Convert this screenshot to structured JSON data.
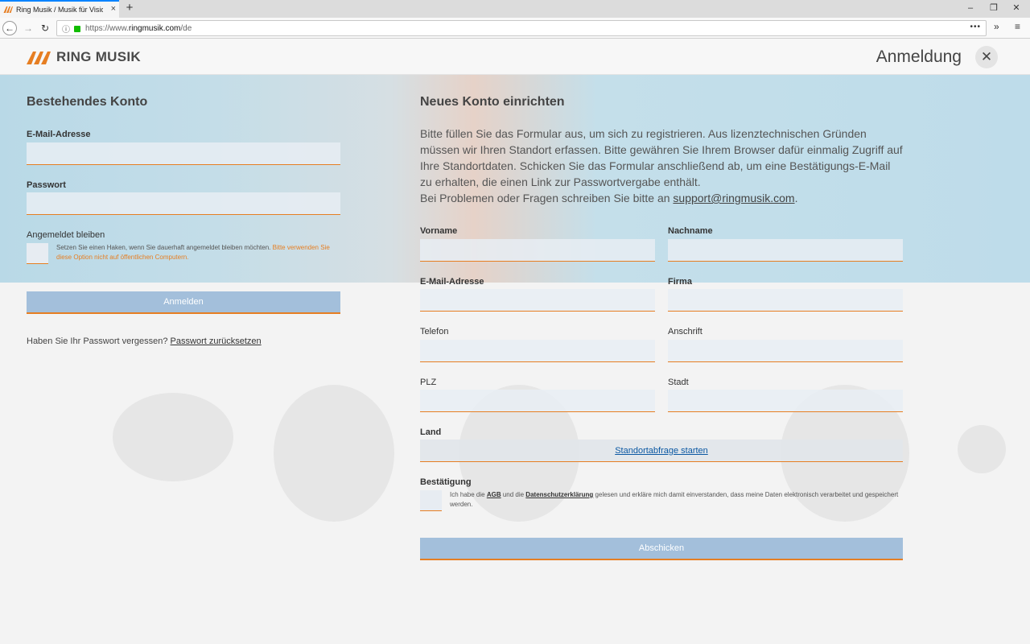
{
  "browser": {
    "tab_title": "Ring Musik / Musik für Visionen",
    "tab_close": "×",
    "new_tab": "+",
    "url_scheme": "https://www.",
    "url_host": "ringmusik.com",
    "url_path": "/de",
    "url_more": "•••",
    "overflow": "»",
    "menu": "≡",
    "win_minimize": "–",
    "win_restore": "❐",
    "win_close": "✕"
  },
  "header": {
    "logo_text": "RING MUSIK",
    "title": "Anmeldung",
    "close_glyph": "✕"
  },
  "login": {
    "heading": "Bestehendes Konto",
    "email_label": "E-Mail-Adresse",
    "password_label": "Passwort",
    "remember_label": "Angemeldet bleiben",
    "remember_hint": "Setzen Sie einen Haken, wenn Sie dauerhaft angemeldet bleiben möchten. ",
    "remember_warn": "Bitte verwenden Sie diese Option nicht auf öffentlichen Computern.",
    "submit_label": "Anmelden",
    "forgot_text": "Haben Sie Ihr Passwort vergessen? ",
    "forgot_link": "Passwort zurücksetzen"
  },
  "register": {
    "heading": "Neues Konto einrichten",
    "intro_text": "Bitte füllen Sie das Formular aus, um sich zu registrieren. Aus lizenztechnischen Gründen müssen wir Ihren Standort erfassen. Bitte gewähren Sie Ihrem Browser dafür einmalig Zugriff auf Ihre Standortdaten. Schicken Sie das Formular anschließend ab, um eine Bestätigungs-E-Mail zu erhalten, die einen Link zur Passwortvergabe enthält.",
    "intro_help": "Bei Problemen oder Fragen schreiben Sie bitte an ",
    "support_email": "support@ringmusik.com",
    "intro_end": ".",
    "fields": {
      "vorname": "Vorname",
      "nachname": "Nachname",
      "email": "E-Mail-Adresse",
      "firma": "Firma",
      "telefon": "Telefon",
      "anschrift": "Anschrift",
      "plz": "PLZ",
      "stadt": "Stadt",
      "land": "Land"
    },
    "location_button": "Standortabfrage starten",
    "confirm_label": "Bestätigung",
    "confirm_text_1": "Ich habe die ",
    "agb_link": "AGB",
    "confirm_text_2": " und die ",
    "privacy_link": "Datenschutzerklärung",
    "confirm_text_3": " gelesen und erkläre mich damit einverstanden, dass meine Daten elektronisch verarbeitet und gespeichert werden.",
    "submit_label": "Abschicken"
  },
  "colors": {
    "accent": "#e67e22",
    "button": "#a3bfdb",
    "link": "#0b58a3",
    "band": "#bedcea"
  }
}
